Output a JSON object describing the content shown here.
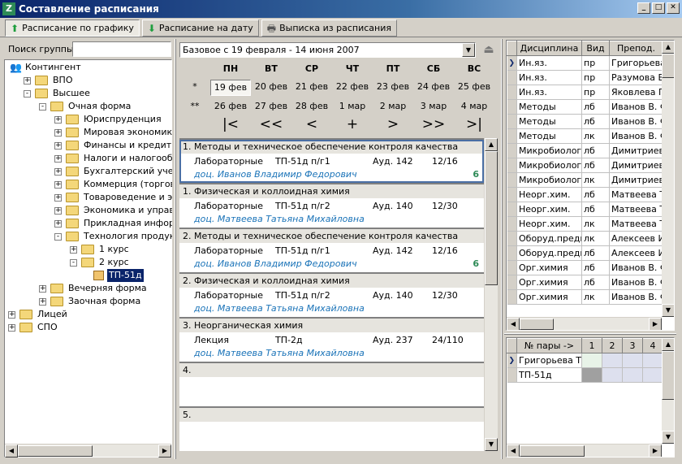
{
  "window": {
    "title": "Составление расписания"
  },
  "tabs": [
    {
      "label": "Расписание по графику",
      "icon": "arrow-up-icon"
    },
    {
      "label": "Расписание на дату",
      "icon": "arrow-down-icon"
    },
    {
      "label": "Выписка из расписания",
      "icon": "printer-icon"
    }
  ],
  "search": {
    "label": "Поиск группы:",
    "value": ""
  },
  "tree": {
    "nodes": [
      {
        "label": "Контингент",
        "level": 0,
        "pm": "",
        "icon": "people"
      },
      {
        "label": "ВПО",
        "level": 1,
        "pm": "+"
      },
      {
        "label": "Высшее",
        "level": 1,
        "pm": "-"
      },
      {
        "label": "Очная форма",
        "level": 2,
        "pm": "-"
      },
      {
        "label": "Юриспруденция",
        "level": 3,
        "pm": "+"
      },
      {
        "label": "Мировая экономика",
        "level": 3,
        "pm": "+"
      },
      {
        "label": "Финансы и кредит",
        "level": 3,
        "pm": "+"
      },
      {
        "label": "Налоги и налогообложе",
        "level": 3,
        "pm": "+"
      },
      {
        "label": "Бухгалтерский учет, ана",
        "level": 3,
        "pm": "+"
      },
      {
        "label": "Коммерция (торговое де",
        "level": 3,
        "pm": "+"
      },
      {
        "label": "Товароведение и экспер",
        "level": 3,
        "pm": "+"
      },
      {
        "label": "Экономика и управление",
        "level": 3,
        "pm": "+"
      },
      {
        "label": "Прикладная информатик",
        "level": 3,
        "pm": "+"
      },
      {
        "label": "Технология продуктов о",
        "level": 3,
        "pm": "-"
      },
      {
        "label": "1 курс",
        "level": 4,
        "pm": "+"
      },
      {
        "label": "2 курс",
        "level": 4,
        "pm": "-"
      },
      {
        "label": "ТП-51д",
        "level": 5,
        "pm": "",
        "selected": true,
        "icon": "group"
      },
      {
        "label": "Вечерняя форма",
        "level": 2,
        "pm": "+"
      },
      {
        "label": "Заочная форма",
        "level": 2,
        "pm": "+"
      },
      {
        "label": "Лицей",
        "level": 0,
        "pm": "+"
      },
      {
        "label": "СПО",
        "level": 0,
        "pm": "+"
      }
    ]
  },
  "period": {
    "value": "Базовое с 19 февраля - 14 июня 2007"
  },
  "calendar": {
    "days": [
      "ПН",
      "ВТ",
      "СР",
      "ЧТ",
      "ПТ",
      "СБ",
      "ВС"
    ],
    "week1_marker": "*",
    "week2_marker": "**",
    "week1": [
      "19 фев",
      "20 фев",
      "21 фев",
      "22 фев",
      "23 фев",
      "24 фев",
      "25 фев"
    ],
    "week2": [
      "26 фев",
      "27 фев",
      "28 фев",
      "1 мар",
      "2 мар",
      "3 мар",
      "4 мар"
    ],
    "nav": [
      "|<",
      "<<",
      "<",
      "+",
      ">",
      ">>",
      ">|"
    ]
  },
  "schedule": [
    {
      "title": "1. Методы и техническое обеспечение контроля качества",
      "type": "Лабораторные",
      "group": "ТП-51д п/г1",
      "room": "Ауд. 142",
      "count": "12/16",
      "teacher": "доц. Иванов Владимир Федорович",
      "num": "6",
      "selected": true
    },
    {
      "title": "1. Физическая и коллоидная химия",
      "type": "Лабораторные",
      "group": "ТП-51д п/г2",
      "room": "Ауд. 140",
      "count": "12/30",
      "teacher": "доц. Матвеева Татьяна Михайловна",
      "num": ""
    },
    {
      "title": "2. Методы и техническое обеспечение контроля качества",
      "type": "Лабораторные",
      "group": "ТП-51д п/г1",
      "room": "Ауд. 142",
      "count": "12/16",
      "teacher": "доц. Иванов Владимир Федорович",
      "num": "6"
    },
    {
      "title": "2. Физическая и коллоидная химия",
      "type": "Лабораторные",
      "group": "ТП-51д п/г2",
      "room": "Ауд. 140",
      "count": "12/30",
      "teacher": "доц. Матвеева Татьяна Михайловна",
      "num": ""
    },
    {
      "title": "3. Неорганическая химия",
      "type": "Лекция",
      "group": "ТП-2д",
      "room": "Ауд. 237",
      "count": "24/110",
      "teacher": "доц. Матвеева Татьяна Михайловна",
      "num": ""
    },
    {
      "title": "4.",
      "type": "",
      "group": "",
      "room": "",
      "count": "",
      "teacher": "",
      "num": ""
    },
    {
      "title": "5.",
      "type": "",
      "group": "",
      "room": "",
      "count": "",
      "teacher": "",
      "num": ""
    }
  ],
  "disciplines": {
    "columns": [
      "Дисциплина",
      "Вид",
      "Препод."
    ],
    "rows": [
      [
        "Ин.яз.",
        "пр",
        "Григорьева Т."
      ],
      [
        "Ин.яз.",
        "пр",
        "Разумова В."
      ],
      [
        "Ин.яз.",
        "пр",
        "Яковлева Г."
      ],
      [
        "Методы",
        "лб",
        "Иванов В. Ф."
      ],
      [
        "Методы",
        "лб",
        "Иванов В. Ф."
      ],
      [
        "Методы",
        "лк",
        "Иванов В. Ф."
      ],
      [
        "Микробиологи",
        "лб",
        "Димитриев А"
      ],
      [
        "Микробиологи",
        "лб",
        "Димитриев А"
      ],
      [
        "Микробиологи",
        "лк",
        "Димитриев А"
      ],
      [
        "Неорг.хим.",
        "лб",
        "Матвеева Т."
      ],
      [
        "Неорг.хим.",
        "лб",
        "Матвеева Т."
      ],
      [
        "Неорг.хим.",
        "лк",
        "Матвеева Т."
      ],
      [
        "Оборуд.предп",
        "лк",
        "Алексеев И."
      ],
      [
        "Оборуд.предп",
        "лб",
        "Алексеев И."
      ],
      [
        "Орг.химия",
        "лб",
        "Иванов В. Ф."
      ],
      [
        "Орг.химия",
        "лб",
        "Иванов В. Ф."
      ],
      [
        "Орг.химия",
        "лк",
        "Иванов В. Ф."
      ]
    ]
  },
  "pairs": {
    "header": "№ пары ->",
    "columns": [
      "1",
      "2",
      "3",
      "4"
    ],
    "rows": [
      "Григорьева Т.Н",
      "ТП-51д"
    ]
  }
}
